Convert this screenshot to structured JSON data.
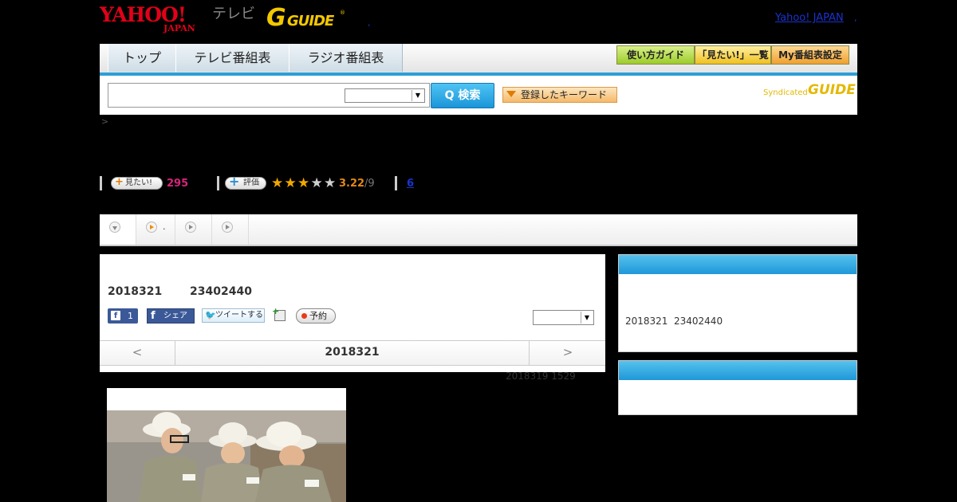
{
  "header": {
    "logo_top": "YAHOO!",
    "logo_bottom": "JAPAN",
    "tv_label": "テレビ",
    "gguide_g": "G",
    "gguide_guide": "GUIDE",
    "gguide_reg": "®",
    "dot1": ",",
    "yahoo_link": "Yahoo! JAPAN",
    "dot2": ","
  },
  "nav": {
    "tabs": [
      "トップ",
      "テレビ番組表",
      "ラジオ番組表"
    ],
    "buttons": [
      "使い方ガイド",
      "「見たい!」一覧",
      "My番組表設定"
    ]
  },
  "search": {
    "button_label": "Q 検索",
    "keyword_button": "登録したキーワード",
    "syndicated": "Syndicated",
    "syndicated_logo": "GUIDE",
    "select_arrow": "▼"
  },
  "breadcrumb": ">",
  "rating": {
    "want_label": "見たい!",
    "want_count": "295",
    "rate_label": "評価",
    "stars": 3.22,
    "score": "3.22",
    "score_total": "/9",
    "review_count": "6"
  },
  "tabs_row": {
    "second_tab_text": "."
  },
  "program": {
    "date": "2018321",
    "time": "23402440",
    "fb_like_count": "1",
    "fb_share": "シェア",
    "tweet": "ツイートする",
    "reserve": "予約",
    "nav_prev": "<",
    "nav_date": "2018321",
    "nav_next": ">",
    "updated": "2018319  1529"
  },
  "sidebar": {
    "box1_date": "2018321",
    "box1_time": "23402440"
  },
  "colors": {
    "accent_blue": "#1f97d8",
    "want_pink": "#d6247c",
    "score_orange": "#e0881a",
    "link_blue": "#1a33cc"
  }
}
